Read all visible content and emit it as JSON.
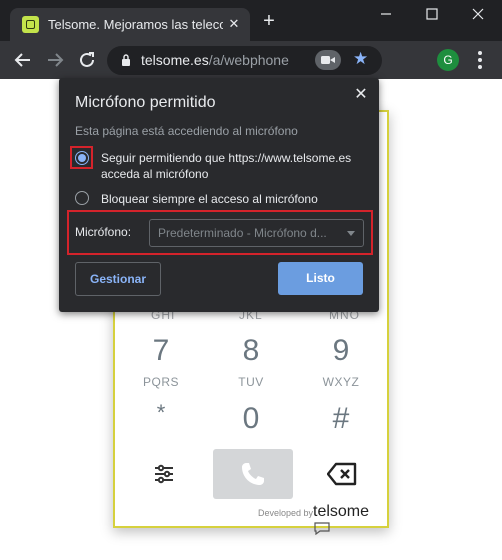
{
  "browser": {
    "tab_title": "Telsome. Mejoramos las telecomunicaciones",
    "url_host": "telsome.es",
    "url_path": "/a/webphone",
    "profile_initial": "G"
  },
  "dialer": {
    "partial_row": [
      "GHI",
      "JKL",
      "MNO"
    ],
    "keys": [
      {
        "digit": "7",
        "letters": "PQRS"
      },
      {
        "digit": "8",
        "letters": "TUV"
      },
      {
        "digit": "9",
        "letters": "WXYZ"
      },
      {
        "digit": "*",
        "letters": ""
      },
      {
        "digit": "0",
        "letters": ""
      },
      {
        "digit": "#",
        "letters": ""
      }
    ],
    "developed_by": "Developed by",
    "brand": "telsome"
  },
  "popup": {
    "title": "Micrófono permitido",
    "subtitle": "Esta página está accediendo al micrófono",
    "option_allow": "Seguir permitiendo que https://www.telsome.es acceda al micrófono",
    "option_block": "Bloquear siempre el acceso al micrófono",
    "mic_label": "Micrófono:",
    "mic_value": "Predeterminado - Micrófono d...",
    "manage_label": "Gestionar",
    "done_label": "Listo"
  },
  "colors": {
    "accent": "#8ab4f8",
    "highlight_box": "#d4232b",
    "phone_border": "#d6d13d"
  }
}
